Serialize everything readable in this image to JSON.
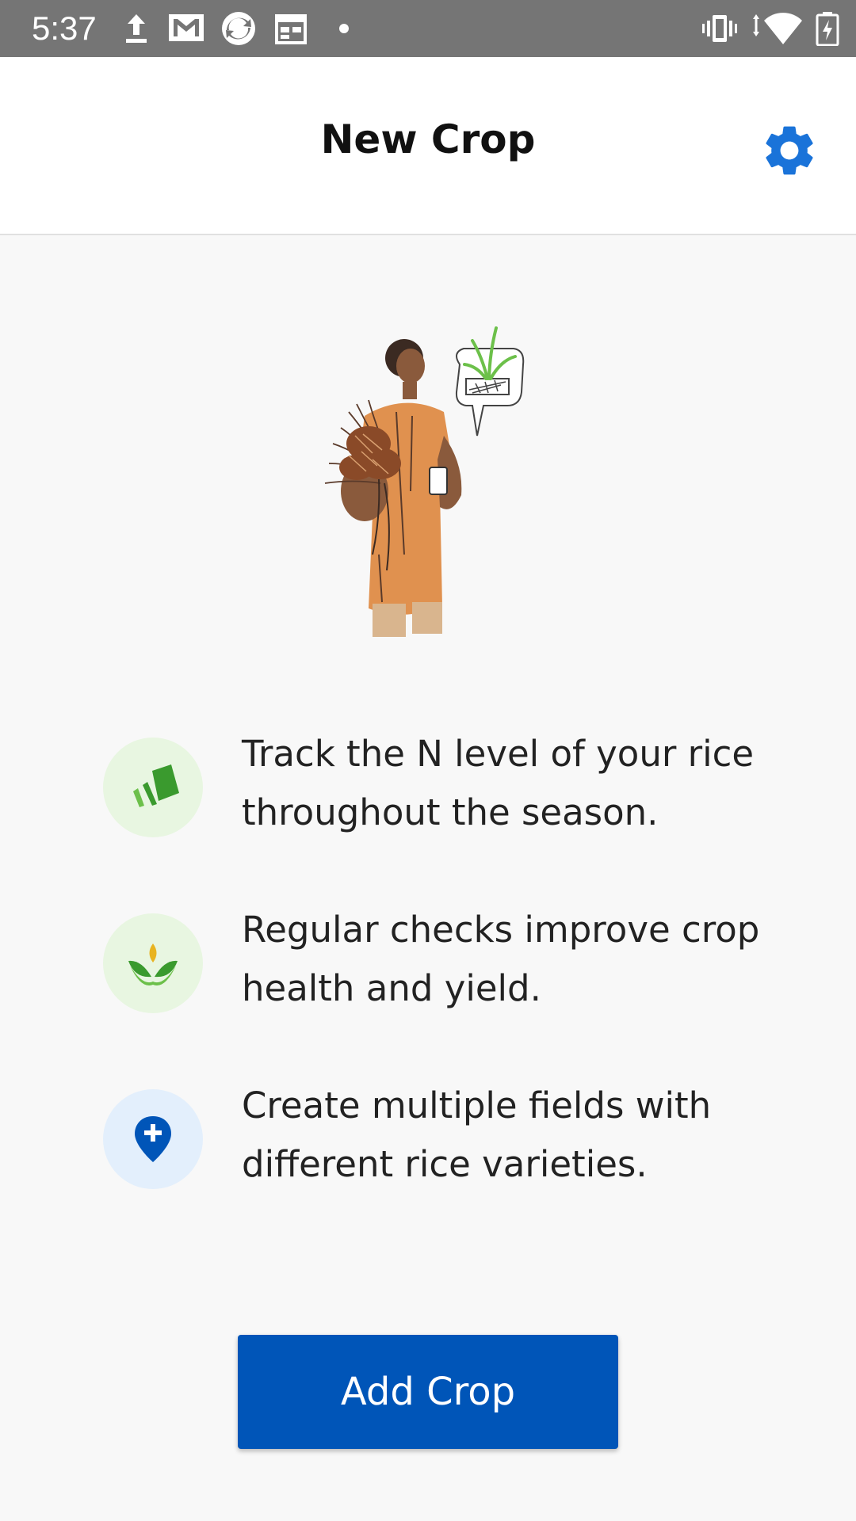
{
  "status_bar": {
    "time": "5:37",
    "left_icons": [
      "upload-icon",
      "gmail-icon",
      "sync-app-icon",
      "calendar-icon",
      "dot-icon"
    ],
    "right_icons": [
      "vibrate-icon",
      "wifi-icon",
      "battery-charging-icon"
    ]
  },
  "header": {
    "title": "New Crop",
    "settings_icon": "gear-icon",
    "accent": "#1a73d9"
  },
  "illustration": {
    "icon": "farmer-with-rice-illustration"
  },
  "features": [
    {
      "icon": "rice-leaf-card-icon",
      "icon_bg": "#e8f6e1",
      "text": "Track the N level of your rice throughout the season."
    },
    {
      "icon": "sprout-icon",
      "icon_bg": "#e8f6e1",
      "text": "Regular checks improve crop health and yield."
    },
    {
      "icon": "add-location-pin-icon",
      "icon_bg": "#e3effc",
      "text": "Create multiple fields with different rice varieties."
    }
  ],
  "add_button": {
    "label": "Add Crop",
    "color": "#0055b8"
  }
}
